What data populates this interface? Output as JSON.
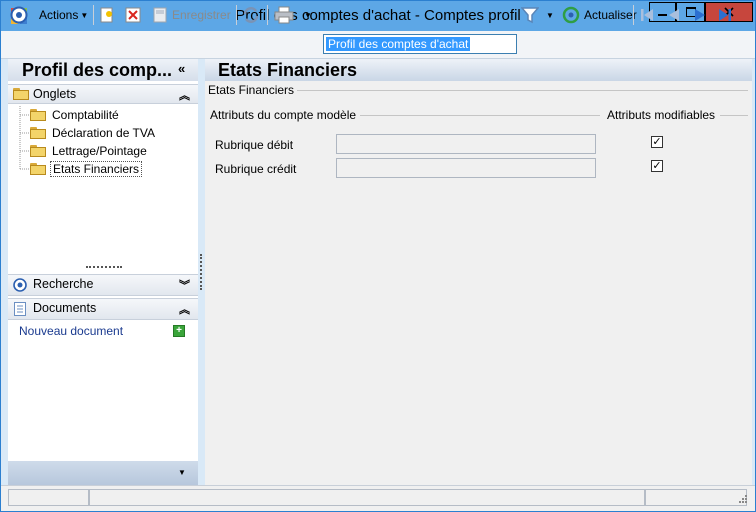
{
  "window": {
    "title": "Profil des comptes d'achat -  Comptes profil"
  },
  "toolbar": {
    "actions_label": "Actions",
    "save_label": "Enregistrer",
    "search_value": "Profil des comptes d'achat",
    "refresh_label": "Actualiser"
  },
  "left": {
    "title": "Profil des comp...",
    "onglets_label": "Onglets",
    "tree": [
      {
        "label": "Comptabilité"
      },
      {
        "label": "Déclaration de TVA"
      },
      {
        "label": "Lettrage/Pointage"
      },
      {
        "label": "Etats Financiers"
      }
    ],
    "recherche_label": "Recherche",
    "documents_label": "Documents",
    "new_document_label": "Nouveau document"
  },
  "main": {
    "title": "Etats Financiers",
    "group_label": "Etats Financiers",
    "attrs_label": "Attributs du compte modèle",
    "editable_label": "Attributs modifiables",
    "rows": [
      {
        "label": "Rubrique débit",
        "value": "",
        "checked": true
      },
      {
        "label": "Rubrique crédit",
        "value": "",
        "checked": true
      }
    ]
  },
  "colors": {
    "titlebar": "#5da7e6",
    "accent": "#2b7fd0",
    "link": "#1a3a8f"
  }
}
